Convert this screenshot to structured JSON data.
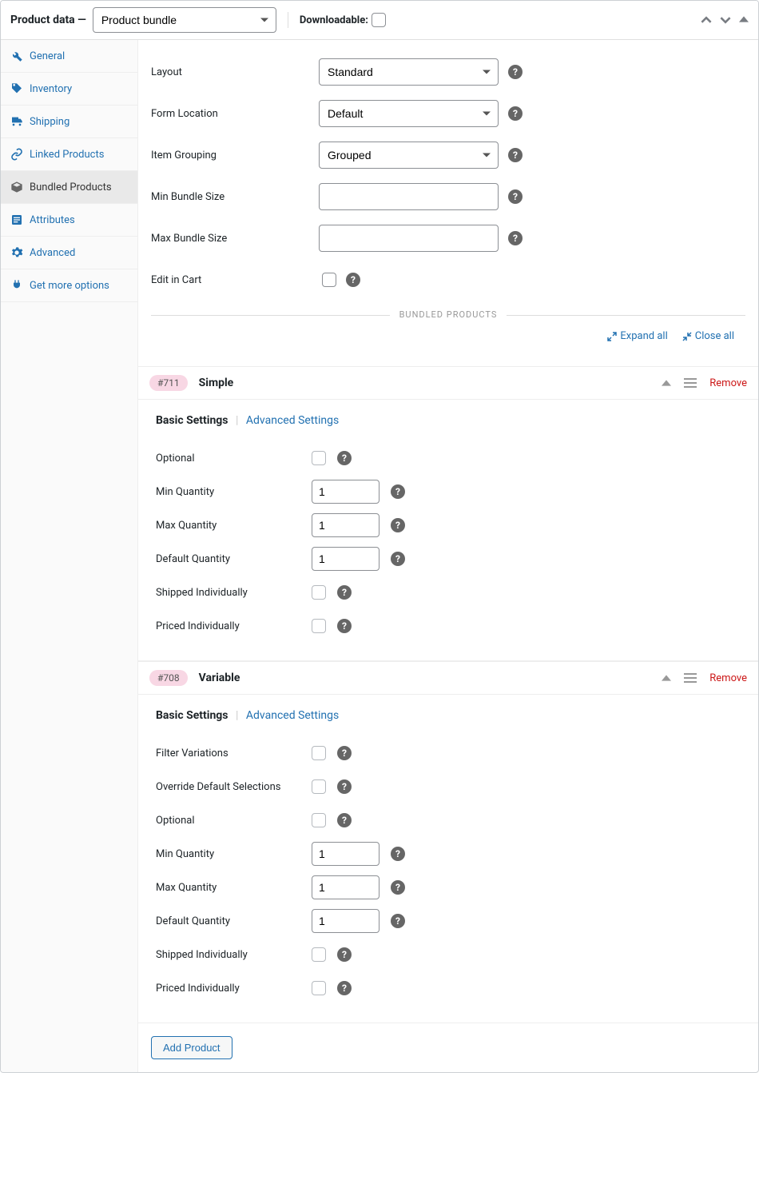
{
  "header": {
    "title": "Product data —",
    "product_type": "Product bundle",
    "downloadable_label": "Downloadable:"
  },
  "sidebar": {
    "items": [
      {
        "label": "General"
      },
      {
        "label": "Inventory"
      },
      {
        "label": "Shipping"
      },
      {
        "label": "Linked Products"
      },
      {
        "label": "Bundled Products"
      },
      {
        "label": "Attributes"
      },
      {
        "label": "Advanced"
      },
      {
        "label": "Get more options"
      }
    ]
  },
  "form": {
    "layout_label": "Layout",
    "layout_value": "Standard",
    "form_location_label": "Form Location",
    "form_location_value": "Default",
    "item_grouping_label": "Item Grouping",
    "item_grouping_value": "Grouped",
    "min_bundle_label": "Min Bundle Size",
    "max_bundle_label": "Max Bundle Size",
    "edit_in_cart_label": "Edit in Cart"
  },
  "bundled_header": "BUNDLED PRODUCTS",
  "tools": {
    "expand": "Expand all",
    "close": "Close all"
  },
  "subtabs": {
    "basic": "Basic Settings",
    "advanced": "Advanced Settings"
  },
  "items": [
    {
      "id": "#711",
      "name": "Simple",
      "remove": "Remove",
      "fields": {
        "optional": "Optional",
        "min_qty": "Min Quantity",
        "min_qty_val": "1",
        "max_qty": "Max Quantity",
        "max_qty_val": "1",
        "def_qty": "Default Quantity",
        "def_qty_val": "1",
        "shipped": "Shipped Individually",
        "priced": "Priced Individually"
      }
    },
    {
      "id": "#708",
      "name": "Variable",
      "remove": "Remove",
      "fields": {
        "filter_var": "Filter Variations",
        "override": "Override Default Selections",
        "optional": "Optional",
        "min_qty": "Min Quantity",
        "min_qty_val": "1",
        "max_qty": "Max Quantity",
        "max_qty_val": "1",
        "def_qty": "Default Quantity",
        "def_qty_val": "1",
        "shipped": "Shipped Individually",
        "priced": "Priced Individually"
      }
    }
  ],
  "footer": {
    "add_product": "Add Product"
  }
}
